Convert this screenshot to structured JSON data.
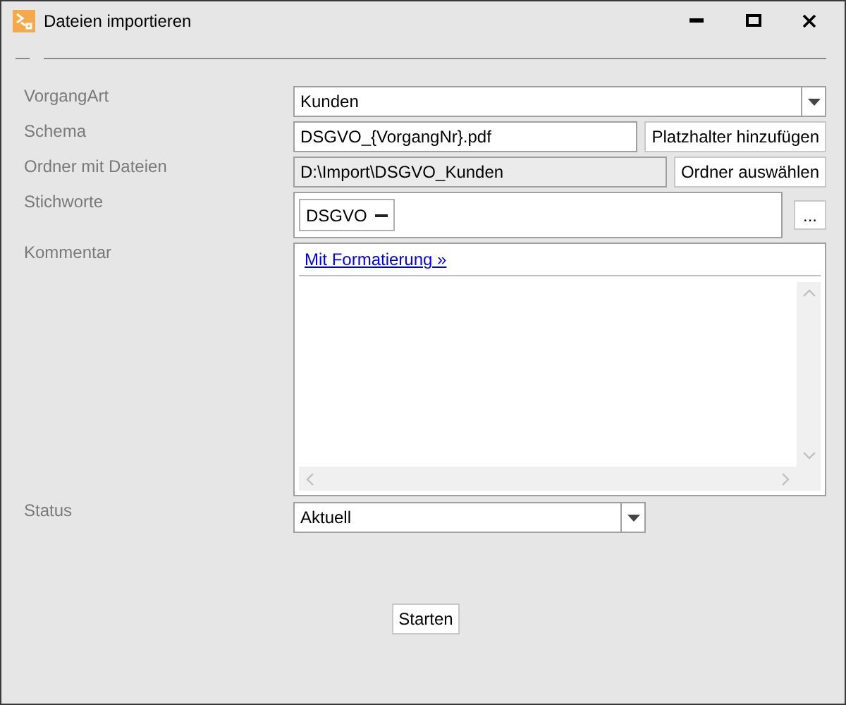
{
  "window": {
    "title": "Dateien importieren"
  },
  "fields": [
    {
      "kind": "select",
      "label": "VorgangArt",
      "value": "Kunden"
    },
    {
      "kind": "text",
      "label": "Schema",
      "value": "DSGVO_{VorgangNr}.pdf",
      "button": "Platzhalter hinzufügen"
    },
    {
      "kind": "readonly",
      "label": "Ordner mit Dateien",
      "value": "D:\\Import\\DSGVO_Kunden",
      "button": "Ordner auswählen"
    },
    {
      "kind": "tags",
      "label": "Stichworte",
      "tags": [
        "DSGVO"
      ],
      "button": "..."
    },
    {
      "kind": "richtext",
      "label": "Kommentar",
      "link": "Mit Formatierung »"
    },
    {
      "kind": "short-select",
      "label": "Status",
      "value": "Aktuell"
    }
  ],
  "action": "Starten"
}
